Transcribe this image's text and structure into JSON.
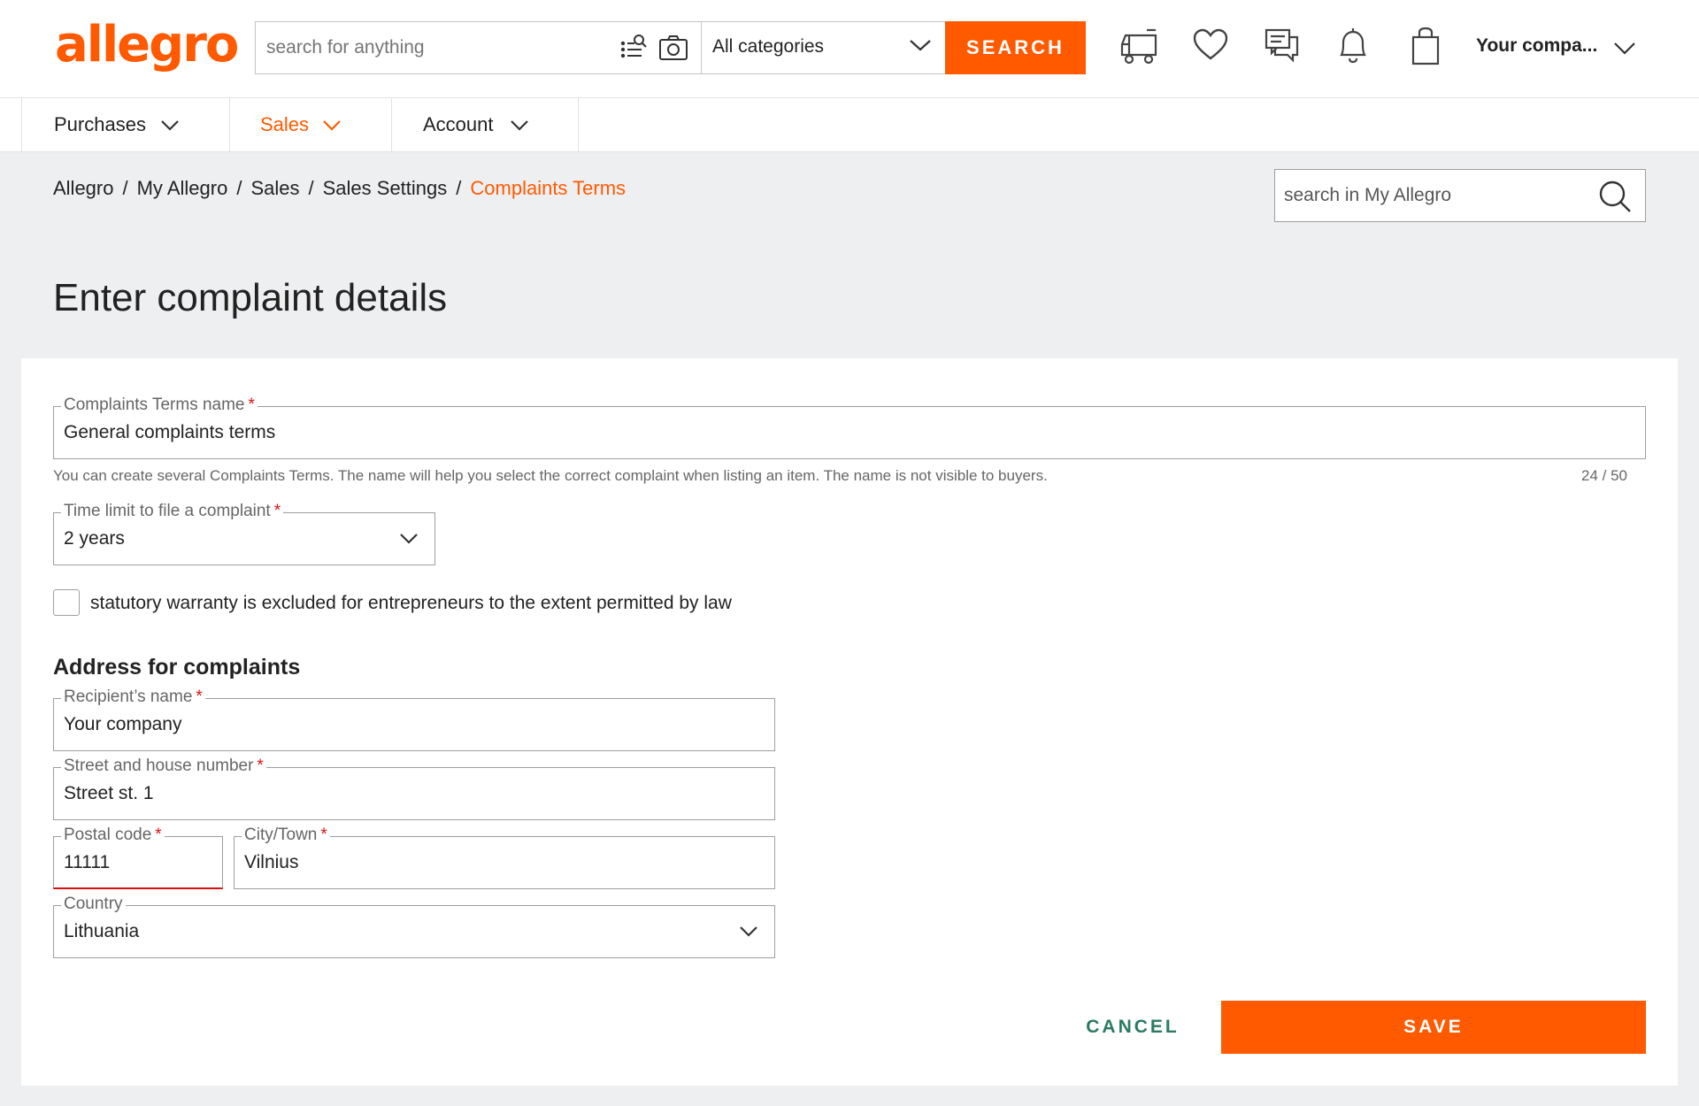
{
  "header": {
    "logo": "allegro",
    "search_placeholder": "search for anything",
    "category": "All categories",
    "search_button": "SEARCH",
    "account": "Your compa...",
    "icons": [
      "search-list-icon",
      "camera-icon",
      "delivery-truck-icon",
      "heart-icon",
      "chat-icon",
      "bell-icon",
      "shopping-bag-icon"
    ]
  },
  "nav": {
    "items": [
      {
        "label": "Purchases",
        "active": false
      },
      {
        "label": "Sales",
        "active": true
      },
      {
        "label": "Account",
        "active": false
      }
    ]
  },
  "breadcrumb": {
    "items": [
      "Allegro",
      "My Allegro",
      "Sales",
      "Sales Settings"
    ],
    "current": "Complaints Terms"
  },
  "my_search": {
    "placeholder": "search in My Allegro"
  },
  "page": {
    "title": "Enter complaint details"
  },
  "form": {
    "terms_name": {
      "label": "Complaints Terms name",
      "value": "General complaints terms"
    },
    "hint": "You can create several Complaints Terms. The name will help you select the correct complaint when listing an item. The name is not visible to buyers.",
    "counter": "24 / 50",
    "time_limit": {
      "label": "Time limit to file a complaint",
      "value": "2 years"
    },
    "warranty_checkbox": {
      "label": "statutory warranty is excluded for entrepreneurs to the extent permitted by law",
      "checked": false
    },
    "address_title": "Address for complaints",
    "recipient": {
      "label": "Recipient’s name",
      "value": "Your company"
    },
    "street": {
      "label": "Street and house number",
      "value": "Street st. 1"
    },
    "postal": {
      "label": "Postal code",
      "value": "11111"
    },
    "city": {
      "label": "City/Town",
      "value": "Vilnius"
    },
    "country": {
      "label": "Country",
      "value": "Lithuania"
    },
    "required_mark": "*"
  },
  "actions": {
    "cancel": "CANCEL",
    "save": "SAVE"
  },
  "colors": {
    "accent": "#ff5a00",
    "cancel": "#2b7a63",
    "required": "#dd1111"
  }
}
